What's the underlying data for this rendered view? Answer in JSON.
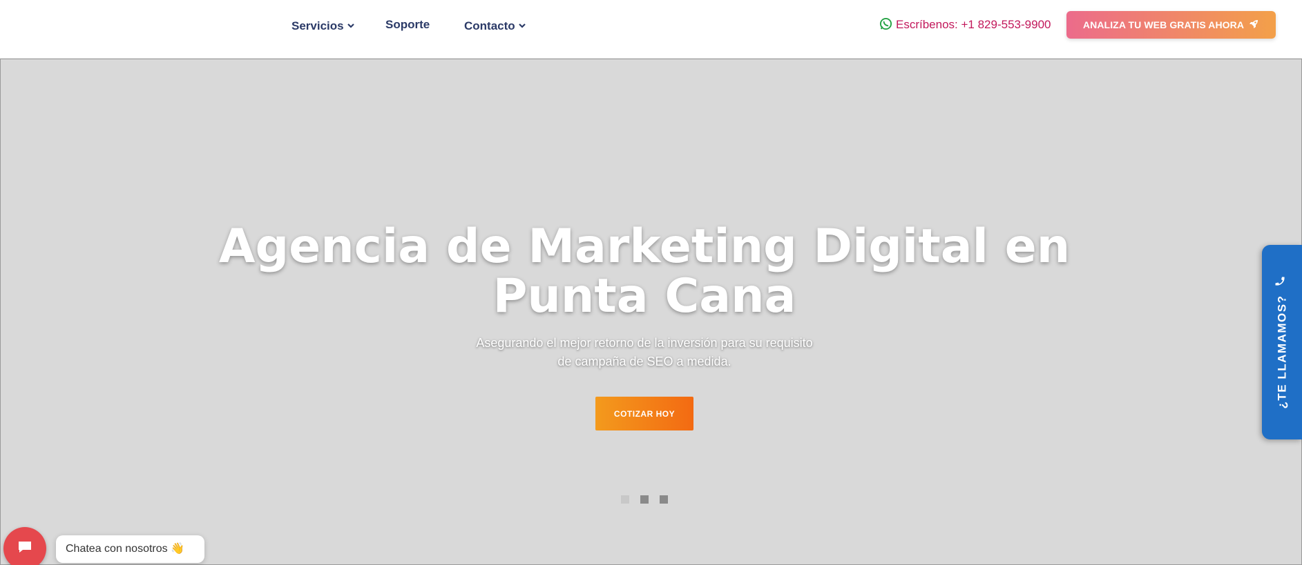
{
  "header": {
    "nav": [
      {
        "label": "Servicios",
        "has_dropdown": true
      },
      {
        "label": "Soporte",
        "has_dropdown": false
      },
      {
        "label": "Contacto",
        "has_dropdown": true
      }
    ],
    "whatsapp": {
      "label": "Escríbenos:",
      "phone": "+1 829-553-9900",
      "icon": "whatsapp-icon"
    },
    "cta": {
      "label": "ANALIZA TU WEB GRATIS AHORA",
      "icon": "rocket-icon"
    }
  },
  "hero": {
    "title": "Agencia de Marketing Digital en Punta Cana",
    "subtitle": "Asegurando el mejor retorno de la inversión para su requisito de campaña de SEO a medida.",
    "cta_label": "COTIZAR HOY",
    "slides": 3,
    "active_slide": 1
  },
  "side_tab": {
    "label": "¿TE LLAMAMOS?",
    "icon": "phone-icon"
  },
  "chat": {
    "label": "Chatea con nosotros 👋",
    "icon": "chat-icon"
  },
  "colors": {
    "nav_text": "#2b3a67",
    "whatsapp_text": "#c2185b",
    "cta_gradient": [
      "#ec6b8b",
      "#f3a049"
    ],
    "hero_cta_gradient": [
      "#f39a1d",
      "#f36a12"
    ],
    "side_tab": "#1f6fc6",
    "chat_button": "#e5484d"
  }
}
